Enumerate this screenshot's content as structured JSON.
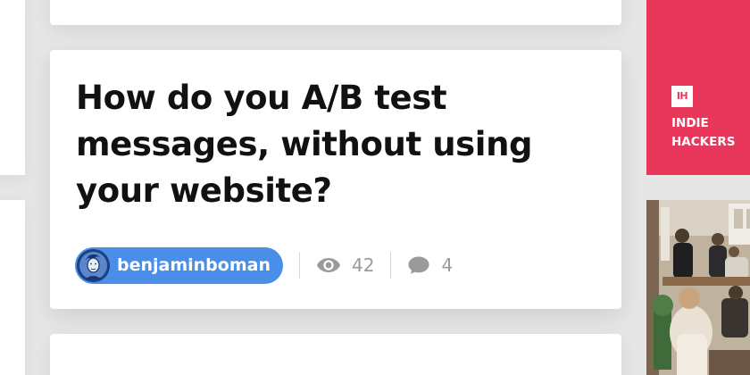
{
  "post": {
    "title": "How do you A/B test messages, without using your website?",
    "author": "benjaminboman",
    "views": "42",
    "comments": "4"
  },
  "banner": {
    "logo_text": "IH",
    "label_line1": "INDIE",
    "label_line2": "HACKERS"
  },
  "colors": {
    "background": "#e6e6e6",
    "card": "#ffffff",
    "title_text": "#111111",
    "user_pill": "#4a8fe7",
    "meta_gray": "#9a9a9a",
    "ih_brand": "#e8375a"
  },
  "icons": {
    "views": "eye-icon",
    "comments": "comment-bubble-icon",
    "logo": "indie-hackers-logo"
  }
}
